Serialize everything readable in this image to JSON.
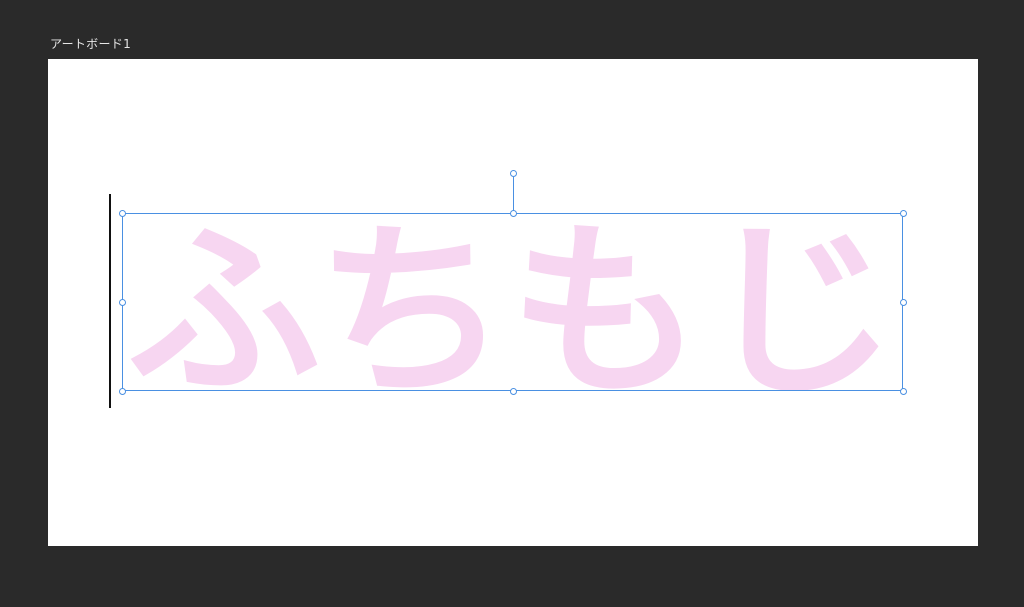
{
  "artboard": {
    "label": "アートボード1",
    "background_color": "#ffffff"
  },
  "canvas": {
    "workspace_color": "#2a2a2a",
    "text_content": "ふちもじ",
    "text_color": "#f7d6f1",
    "selection_color": "#4a90e2"
  }
}
